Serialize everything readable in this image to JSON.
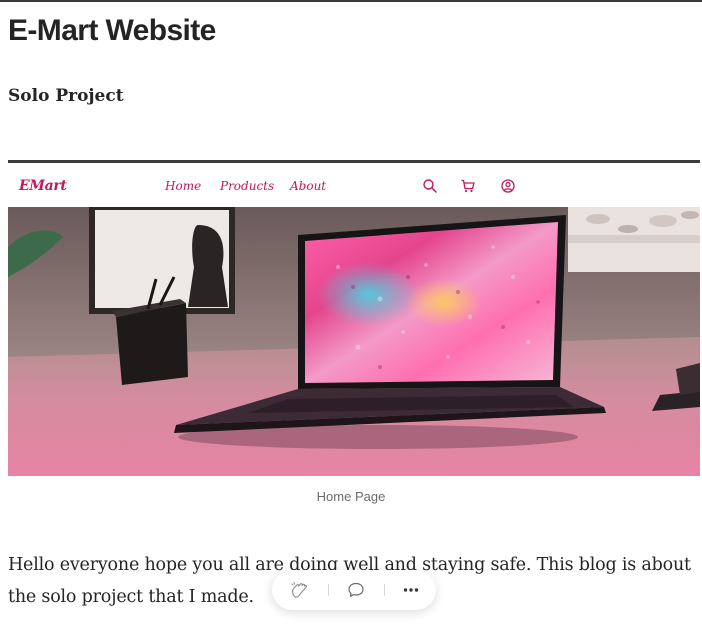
{
  "post": {
    "title": "E-Mart Website",
    "subtitle": "Solo Project"
  },
  "figure": {
    "site_nav": {
      "brand": "EMart",
      "links": [
        "Home",
        "Products",
        "About"
      ],
      "icons": [
        "search-icon",
        "cart-icon",
        "user-icon"
      ]
    },
    "hero_image": "laptop-on-desk-photo",
    "caption": "Home Page"
  },
  "body": {
    "paragraph": "Hello everyone hope you all are doing well and staying safe. This blog is about the solo project that I made."
  },
  "action_bar": {
    "icons": [
      "clap-icon",
      "comment-icon",
      "more-icon"
    ]
  },
  "colors": {
    "brand_pink": "#c2185b",
    "text": "#242424",
    "caption": "#6b6b6b"
  }
}
